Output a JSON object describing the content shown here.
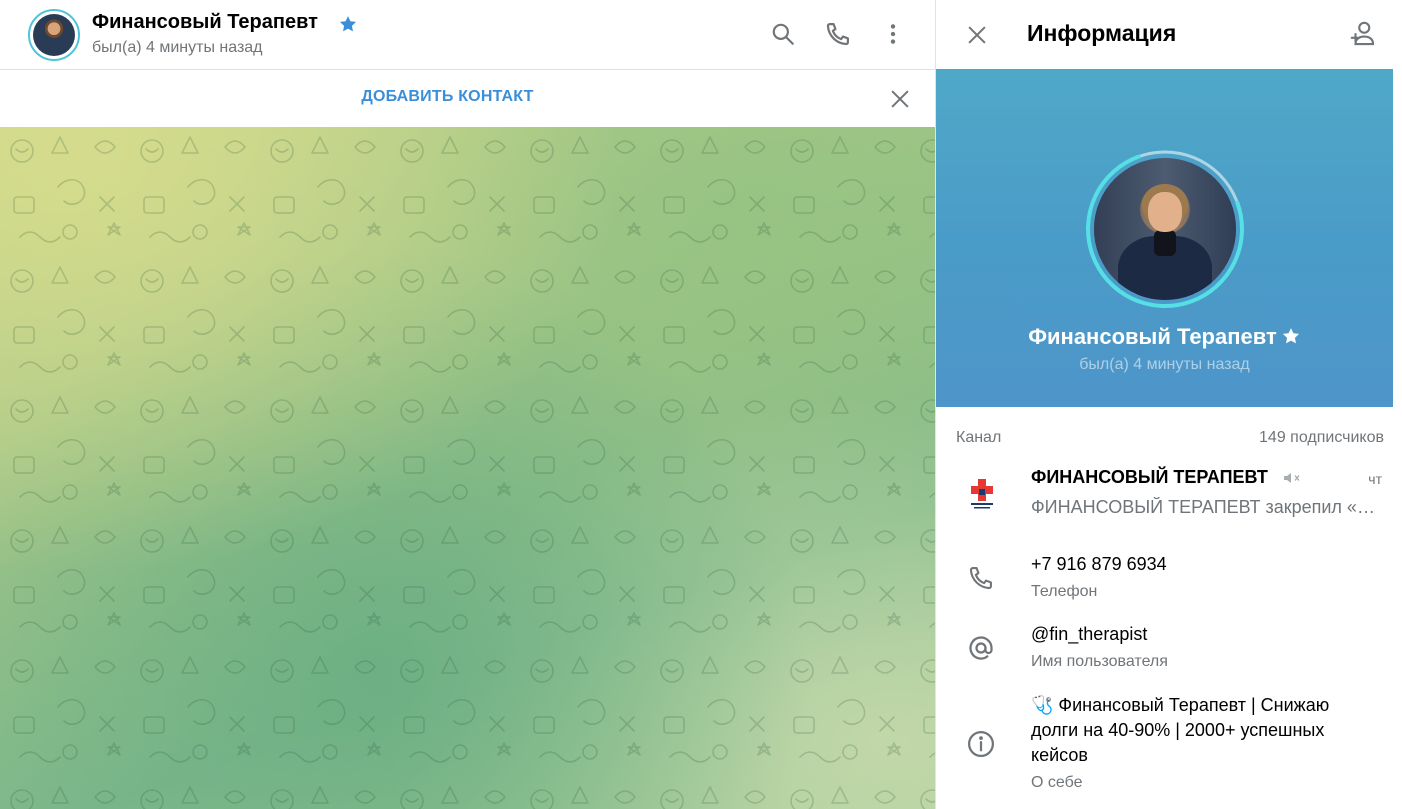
{
  "chat_header": {
    "name": "Финансовый Терапевт",
    "status": "был(а) 4 минуты назад",
    "icons": [
      "search-icon",
      "phone-icon",
      "more-vertical-icon"
    ]
  },
  "add_contact_bar": {
    "label": "ДОБАВИТЬ КОНТАКТ"
  },
  "info_panel": {
    "title": "Информация",
    "profile_name": "Финансовый Терапевт",
    "profile_status": "был(а) 4 минуты назад",
    "channel": {
      "label": "Канал",
      "subscribers": "149 подписчиков",
      "title": "ФИНАНСОВЫЙ ТЕРАПЕВТ",
      "time": "чт",
      "preview": "ФИНАНСОВЫЙ ТЕРАПЕВТ закрепил «Ознакомьтесь»"
    },
    "phone": {
      "value": "+7 916 879 6934",
      "label": "Телефон"
    },
    "username": {
      "value": "@fin_therapist",
      "label": "Имя пользователя"
    },
    "bio": {
      "value": "🩺 Финансовый Терапевт | Снижаю долги на 40-90% | 2000+ успешных кейсов",
      "label": "О себе"
    }
  },
  "colors": {
    "accent": "#3a8fd8",
    "secondary_text": "#707579",
    "star": "#3a8fd8",
    "avatar_ring": "#4fc3d9"
  }
}
